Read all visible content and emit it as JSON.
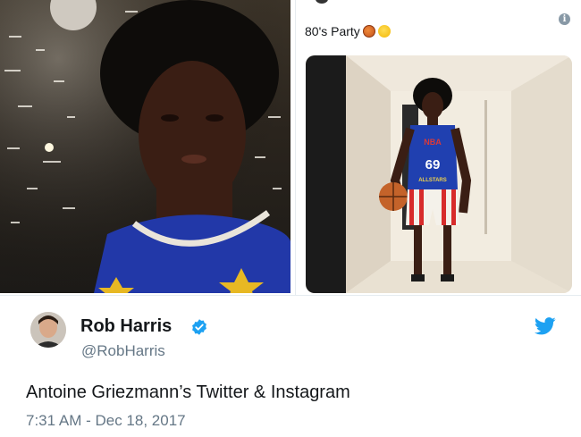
{
  "embed": {
    "caption": "80's Party",
    "caption_emojis": [
      "basketball-emoji",
      "grinning-face-emoji"
    ],
    "info_icon": "info-icon",
    "jersey_text": "69",
    "jersey_team": "ALLSTARS",
    "jersey_logo": "NBA"
  },
  "tweet": {
    "author_name": "Rob Harris",
    "author_handle": "@RobHarris",
    "verified": true,
    "text": "Antoine Griezmann’s Twitter & Instagram",
    "timestamp": "7:31 AM - Dec 18, 2017",
    "brand_color": "#1da1f2",
    "secondary_text_color": "#657786"
  }
}
